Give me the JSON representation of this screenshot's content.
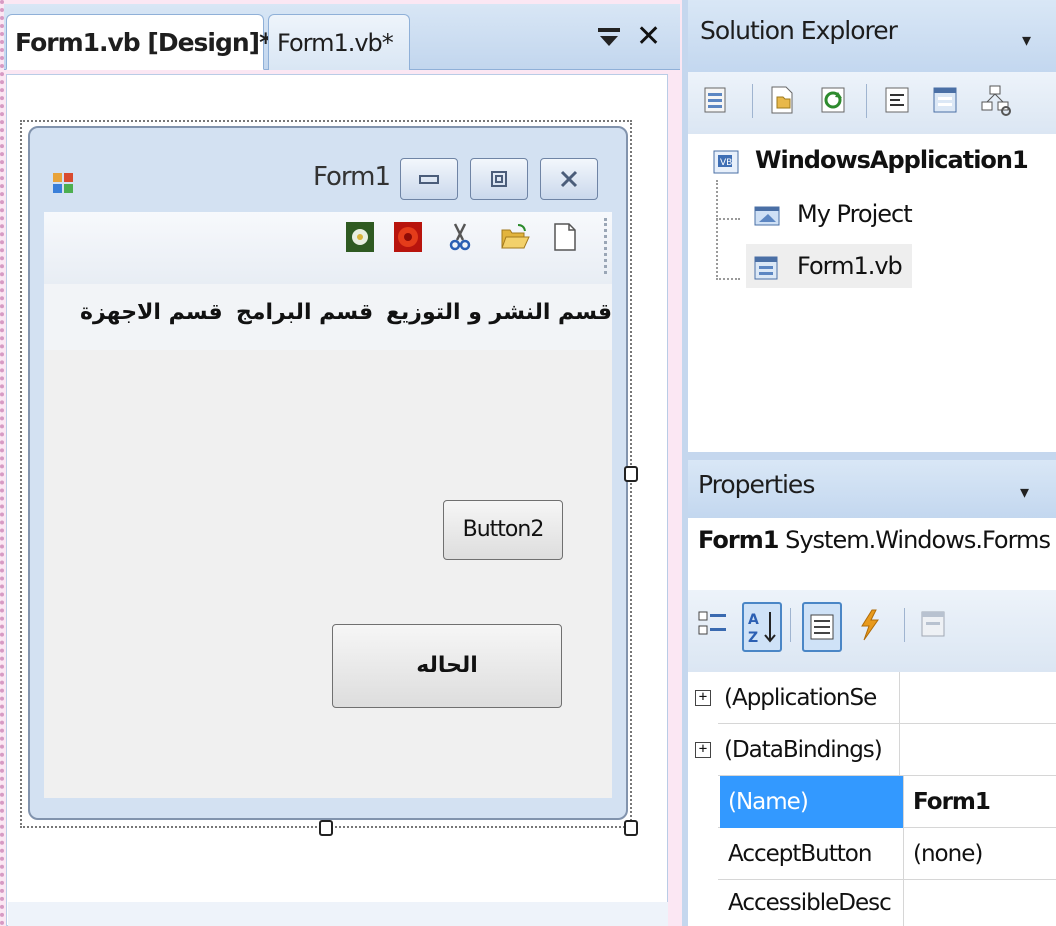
{
  "document_tabs": {
    "design_tab": "Form1.vb [Design]*",
    "code_tab": "Form1.vb*",
    "pin_glyph": "▾",
    "close_glyph": "✕"
  },
  "form": {
    "title": "Form1",
    "icon": "form-app-icon",
    "caption_buttons": {
      "minimize": "▭",
      "maximize": "⧠",
      "close": "⨯"
    },
    "toolstrip_icons": [
      "flower-green-icon",
      "flower-red-icon",
      "cut-icon",
      "open-folder-icon",
      "new-document-icon"
    ],
    "menu_items": [
      "قسم النشر و التوزيع",
      "قسم البرامج",
      "قسم الاجهزة"
    ],
    "button2_label": "Button2",
    "status_button_label": "الحاله"
  },
  "solution_explorer": {
    "title": "Solution Explorer",
    "dropdown_glyph": "▾",
    "toolbar_icons": [
      "properties-icon",
      "show-all-files-icon",
      "refresh-icon",
      "view-code-icon",
      "view-designer-icon",
      "class-diagram-icon"
    ],
    "tree": {
      "root": "WindowsApplication1",
      "children": [
        "My Project",
        "Form1.vb"
      ]
    }
  },
  "properties": {
    "title": "Properties",
    "dropdown_glyph": "▾",
    "object_name": "Form1",
    "object_type": "System.Windows.Forms",
    "toolbar_icons": [
      "categorized-icon",
      "alphabetical-icon",
      "properties-view-icon",
      "events-icon",
      "property-pages-icon"
    ],
    "rows": [
      {
        "name": "(ApplicationSe",
        "value": "",
        "expandable": true,
        "expander": "+"
      },
      {
        "name": "(DataBindings)",
        "value": "",
        "expandable": true,
        "expander": "+"
      },
      {
        "name": "(Name)",
        "value": "Form1",
        "selected": true
      },
      {
        "name": "AcceptButton",
        "value": "(none)"
      },
      {
        "name": "AccessibleDesc",
        "value": ""
      }
    ]
  },
  "colors": {
    "selection": "#3399ff",
    "panel_header": "#c3d7ef",
    "form_frame": "#d3e1f2"
  }
}
